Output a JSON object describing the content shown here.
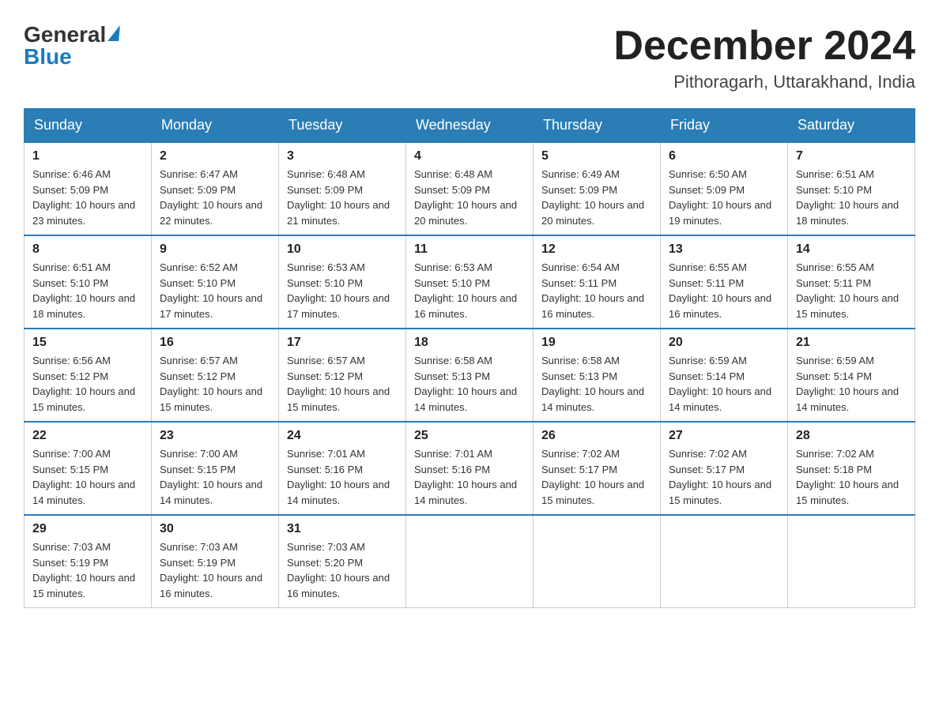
{
  "header": {
    "logo_general": "General",
    "logo_blue": "Blue",
    "month_title": "December 2024",
    "location": "Pithoragarh, Uttarakhand, India"
  },
  "days_of_week": [
    "Sunday",
    "Monday",
    "Tuesday",
    "Wednesday",
    "Thursday",
    "Friday",
    "Saturday"
  ],
  "weeks": [
    [
      {
        "day": "1",
        "sunrise": "6:46 AM",
        "sunset": "5:09 PM",
        "daylight": "10 hours and 23 minutes."
      },
      {
        "day": "2",
        "sunrise": "6:47 AM",
        "sunset": "5:09 PM",
        "daylight": "10 hours and 22 minutes."
      },
      {
        "day": "3",
        "sunrise": "6:48 AM",
        "sunset": "5:09 PM",
        "daylight": "10 hours and 21 minutes."
      },
      {
        "day": "4",
        "sunrise": "6:48 AM",
        "sunset": "5:09 PM",
        "daylight": "10 hours and 20 minutes."
      },
      {
        "day": "5",
        "sunrise": "6:49 AM",
        "sunset": "5:09 PM",
        "daylight": "10 hours and 20 minutes."
      },
      {
        "day": "6",
        "sunrise": "6:50 AM",
        "sunset": "5:09 PM",
        "daylight": "10 hours and 19 minutes."
      },
      {
        "day": "7",
        "sunrise": "6:51 AM",
        "sunset": "5:10 PM",
        "daylight": "10 hours and 18 minutes."
      }
    ],
    [
      {
        "day": "8",
        "sunrise": "6:51 AM",
        "sunset": "5:10 PM",
        "daylight": "10 hours and 18 minutes."
      },
      {
        "day": "9",
        "sunrise": "6:52 AM",
        "sunset": "5:10 PM",
        "daylight": "10 hours and 17 minutes."
      },
      {
        "day": "10",
        "sunrise": "6:53 AM",
        "sunset": "5:10 PM",
        "daylight": "10 hours and 17 minutes."
      },
      {
        "day": "11",
        "sunrise": "6:53 AM",
        "sunset": "5:10 PM",
        "daylight": "10 hours and 16 minutes."
      },
      {
        "day": "12",
        "sunrise": "6:54 AM",
        "sunset": "5:11 PM",
        "daylight": "10 hours and 16 minutes."
      },
      {
        "day": "13",
        "sunrise": "6:55 AM",
        "sunset": "5:11 PM",
        "daylight": "10 hours and 16 minutes."
      },
      {
        "day": "14",
        "sunrise": "6:55 AM",
        "sunset": "5:11 PM",
        "daylight": "10 hours and 15 minutes."
      }
    ],
    [
      {
        "day": "15",
        "sunrise": "6:56 AM",
        "sunset": "5:12 PM",
        "daylight": "10 hours and 15 minutes."
      },
      {
        "day": "16",
        "sunrise": "6:57 AM",
        "sunset": "5:12 PM",
        "daylight": "10 hours and 15 minutes."
      },
      {
        "day": "17",
        "sunrise": "6:57 AM",
        "sunset": "5:12 PM",
        "daylight": "10 hours and 15 minutes."
      },
      {
        "day": "18",
        "sunrise": "6:58 AM",
        "sunset": "5:13 PM",
        "daylight": "10 hours and 14 minutes."
      },
      {
        "day": "19",
        "sunrise": "6:58 AM",
        "sunset": "5:13 PM",
        "daylight": "10 hours and 14 minutes."
      },
      {
        "day": "20",
        "sunrise": "6:59 AM",
        "sunset": "5:14 PM",
        "daylight": "10 hours and 14 minutes."
      },
      {
        "day": "21",
        "sunrise": "6:59 AM",
        "sunset": "5:14 PM",
        "daylight": "10 hours and 14 minutes."
      }
    ],
    [
      {
        "day": "22",
        "sunrise": "7:00 AM",
        "sunset": "5:15 PM",
        "daylight": "10 hours and 14 minutes."
      },
      {
        "day": "23",
        "sunrise": "7:00 AM",
        "sunset": "5:15 PM",
        "daylight": "10 hours and 14 minutes."
      },
      {
        "day": "24",
        "sunrise": "7:01 AM",
        "sunset": "5:16 PM",
        "daylight": "10 hours and 14 minutes."
      },
      {
        "day": "25",
        "sunrise": "7:01 AM",
        "sunset": "5:16 PM",
        "daylight": "10 hours and 14 minutes."
      },
      {
        "day": "26",
        "sunrise": "7:02 AM",
        "sunset": "5:17 PM",
        "daylight": "10 hours and 15 minutes."
      },
      {
        "day": "27",
        "sunrise": "7:02 AM",
        "sunset": "5:17 PM",
        "daylight": "10 hours and 15 minutes."
      },
      {
        "day": "28",
        "sunrise": "7:02 AM",
        "sunset": "5:18 PM",
        "daylight": "10 hours and 15 minutes."
      }
    ],
    [
      {
        "day": "29",
        "sunrise": "7:03 AM",
        "sunset": "5:19 PM",
        "daylight": "10 hours and 15 minutes."
      },
      {
        "day": "30",
        "sunrise": "7:03 AM",
        "sunset": "5:19 PM",
        "daylight": "10 hours and 16 minutes."
      },
      {
        "day": "31",
        "sunrise": "7:03 AM",
        "sunset": "5:20 PM",
        "daylight": "10 hours and 16 minutes."
      },
      null,
      null,
      null,
      null
    ]
  ],
  "labels": {
    "sunrise_prefix": "Sunrise: ",
    "sunset_prefix": "Sunset: ",
    "daylight_prefix": "Daylight: "
  }
}
